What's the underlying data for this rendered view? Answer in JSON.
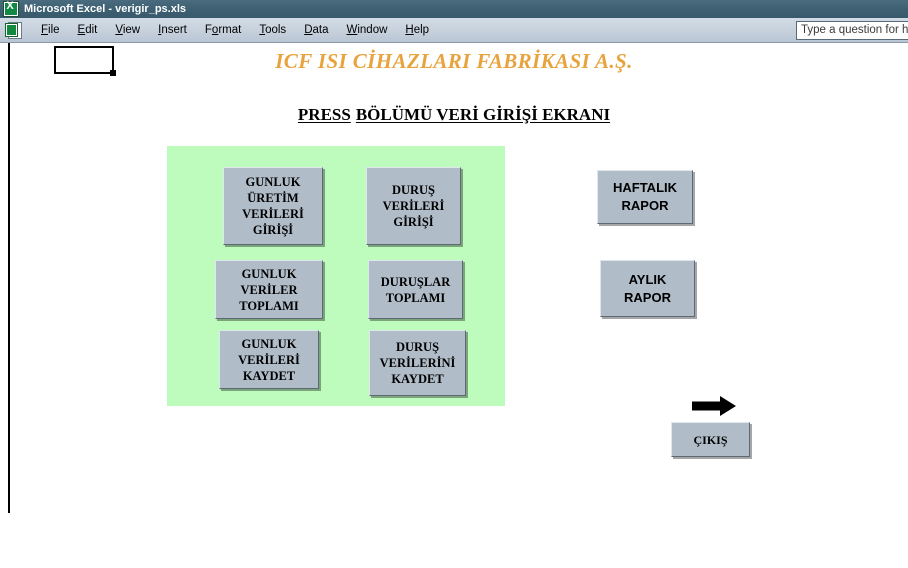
{
  "window": {
    "app_icon": "excel-logo-icon",
    "title": "Microsoft Excel - verigir_ps.xls"
  },
  "menubar": {
    "doc_icon": "worksheet-document-icon",
    "items": [
      {
        "label": "File",
        "mnemonic": "F"
      },
      {
        "label": "Edit",
        "mnemonic": "E"
      },
      {
        "label": "View",
        "mnemonic": "V"
      },
      {
        "label": "Insert",
        "mnemonic": "I"
      },
      {
        "label": "Format",
        "mnemonic": "o"
      },
      {
        "label": "Tools",
        "mnemonic": "T"
      },
      {
        "label": "Data",
        "mnemonic": "D"
      },
      {
        "label": "Window",
        "mnemonic": "W"
      },
      {
        "label": "Help",
        "mnemonic": "H"
      }
    ],
    "ask_a_question": {
      "value": "",
      "placeholder": "Type a question for help"
    }
  },
  "sheet": {
    "company_title": "ICF ISI CİHAZLARI FABRİKASI A.Ş.",
    "company_title_color": "#e8a33d",
    "screen_title_part1": "PRESS",
    "screen_title_part2": "BÖLÜMÜ VERİ GİRİŞİ EKRANI",
    "panel_color": "#bdfcbd",
    "button_face_color": "#b0bcc8",
    "buttons": {
      "uretim_giris": "GUNLUK\nÜRETİM\nVERİLERİ\nGİRİŞİ",
      "durus_giris": "DURUŞ\nVERİLERİ\nGİRİŞİ",
      "veriler_toplami": "GUNLUK\nVERİLER\nTOPLAMI",
      "duruslar_toplami": "DURUŞLAR\nTOPLAMI",
      "verileri_kaydet": "GUNLUK\nVERİLERİ\nKAYDET",
      "durus_kaydet": "DURUŞ\nVERİLERİNİ\nKAYDET",
      "haftalik_rapor": "HAFTALIK\nRAPOR",
      "aylik_rapor": "AYLIK\nRAPOR",
      "cikis": "ÇIKIŞ"
    },
    "exit_arrow_icon": "right-arrow-icon"
  }
}
